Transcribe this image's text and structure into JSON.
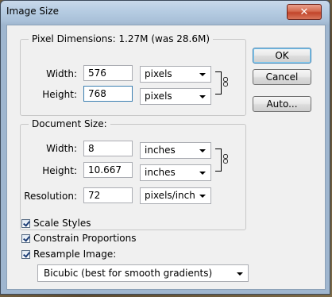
{
  "window": {
    "title": "Image Size",
    "close_glyph": "✕"
  },
  "pixel_dimensions": {
    "legend": "Pixel Dimensions:  1.27M (was 28.6M)",
    "width_label": "Width:",
    "width_value": "576",
    "width_unit": "pixels",
    "height_label": "Height:",
    "height_value": "768",
    "height_unit": "pixels"
  },
  "document_size": {
    "legend": "Document Size:",
    "width_label": "Width:",
    "width_value": "8",
    "width_unit": "inches",
    "height_label": "Height:",
    "height_value": "10.667",
    "height_unit": "inches",
    "resolution_label": "Resolution:",
    "resolution_value": "72",
    "resolution_unit": "pixels/inch"
  },
  "buttons": {
    "ok": "OK",
    "cancel": "Cancel",
    "auto": "Auto..."
  },
  "options": {
    "scale_styles": "Scale Styles",
    "constrain_proportions": "Constrain Proportions",
    "resample_image": "Resample Image:",
    "resample_method": "Bicubic (best for smooth gradients)"
  }
}
